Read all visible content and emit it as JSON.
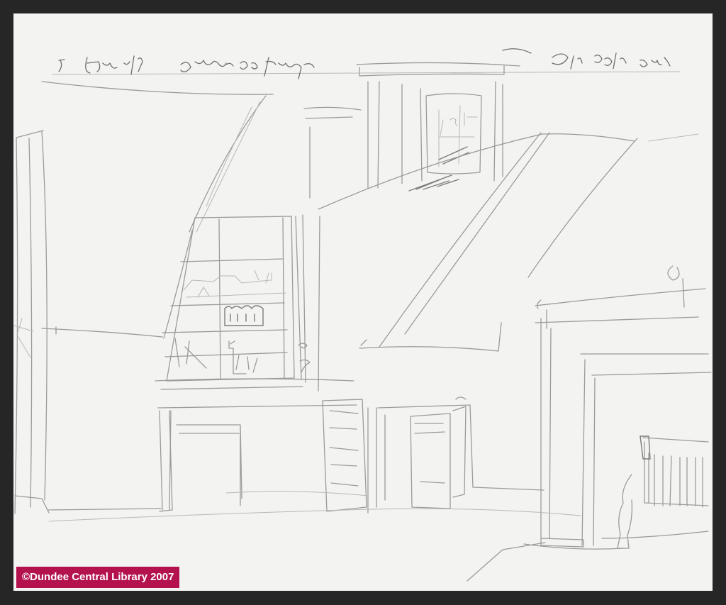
{
  "artwork": {
    "description_icon": "pencil-sketch-image",
    "inscription_left": "5. June 17/81 Same as former",
    "inscription_right": "R. D. Cooke Lou"
  },
  "copyright": {
    "label": "©Dundee Central Library 2007",
    "background_color": "#b3124f",
    "text_color": "#ffffff"
  },
  "frame": {
    "border_color": "#262626",
    "paper_color": "#f3f3f1"
  }
}
